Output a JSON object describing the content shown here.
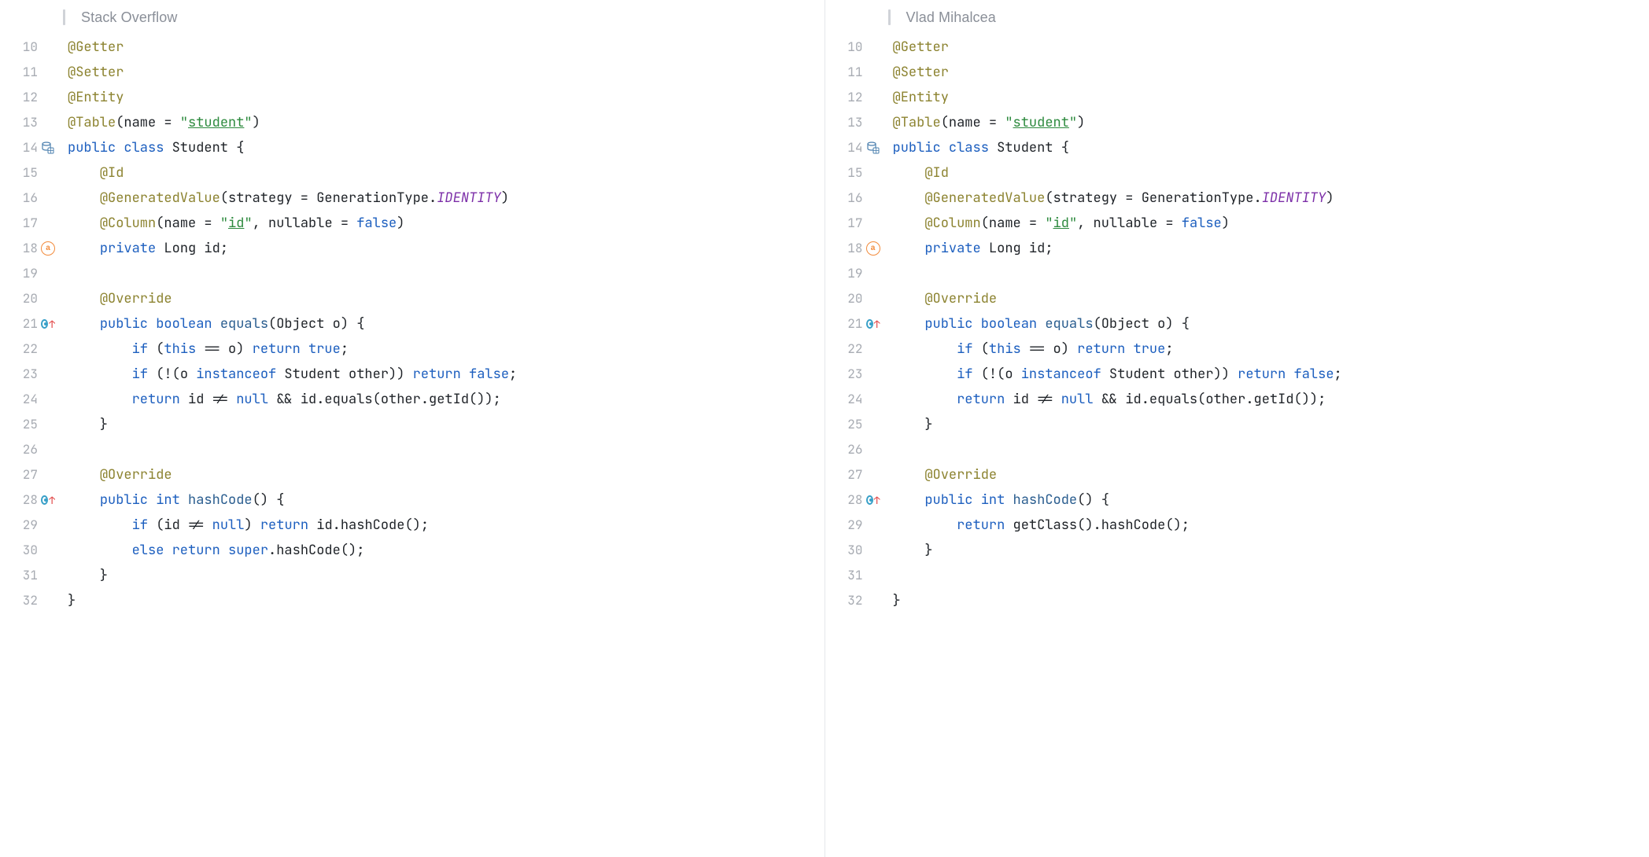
{
  "left": {
    "title": "Stack Overflow",
    "lines": [
      {
        "n": 10,
        "tokens": [
          {
            "t": "@Getter",
            "c": "anno"
          }
        ]
      },
      {
        "n": 11,
        "tokens": [
          {
            "t": "@Setter",
            "c": "anno"
          }
        ]
      },
      {
        "n": 12,
        "tokens": [
          {
            "t": "@Entity",
            "c": "anno"
          }
        ]
      },
      {
        "n": 13,
        "tokens": [
          {
            "t": "@Table",
            "c": "anno"
          },
          {
            "t": "(name = ",
            "c": "punct"
          },
          {
            "t": "\"",
            "c": "str"
          },
          {
            "t": "student",
            "c": "str strul"
          },
          {
            "t": "\"",
            "c": "str"
          },
          {
            "t": ")",
            "c": "punct"
          }
        ]
      },
      {
        "n": 14,
        "icon": "db",
        "tokens": [
          {
            "t": "public ",
            "c": "kw"
          },
          {
            "t": "class ",
            "c": "kw"
          },
          {
            "t": "Student {",
            "c": "ident"
          }
        ]
      },
      {
        "n": 15,
        "tokens": [
          {
            "t": "    ",
            "c": ""
          },
          {
            "t": "@Id",
            "c": "anno"
          }
        ]
      },
      {
        "n": 16,
        "tokens": [
          {
            "t": "    ",
            "c": ""
          },
          {
            "t": "@GeneratedValue",
            "c": "anno"
          },
          {
            "t": "(strategy = GenerationType.",
            "c": "punct"
          },
          {
            "t": "IDENTITY",
            "c": "const"
          },
          {
            "t": ")",
            "c": "punct"
          }
        ]
      },
      {
        "n": 17,
        "tokens": [
          {
            "t": "    ",
            "c": ""
          },
          {
            "t": "@Column",
            "c": "anno"
          },
          {
            "t": "(name = ",
            "c": "punct"
          },
          {
            "t": "\"",
            "c": "str"
          },
          {
            "t": "id",
            "c": "str strul"
          },
          {
            "t": "\"",
            "c": "str"
          },
          {
            "t": ", nullable = ",
            "c": "punct"
          },
          {
            "t": "false",
            "c": "kw"
          },
          {
            "t": ")",
            "c": "punct"
          }
        ]
      },
      {
        "n": 18,
        "icon": "at",
        "tokens": [
          {
            "t": "    ",
            "c": ""
          },
          {
            "t": "private ",
            "c": "kw"
          },
          {
            "t": "Long id;",
            "c": "ident"
          }
        ]
      },
      {
        "n": 19,
        "tokens": []
      },
      {
        "n": 20,
        "tokens": [
          {
            "t": "    ",
            "c": ""
          },
          {
            "t": "@Override",
            "c": "anno"
          }
        ]
      },
      {
        "n": 21,
        "icon": "ov",
        "tokens": [
          {
            "t": "    ",
            "c": ""
          },
          {
            "t": "public ",
            "c": "kw"
          },
          {
            "t": "boolean ",
            "c": "kw"
          },
          {
            "t": "equals",
            "c": "method"
          },
          {
            "t": "(Object o) {",
            "c": "ident"
          }
        ]
      },
      {
        "n": 22,
        "tokens": [
          {
            "t": "        ",
            "c": ""
          },
          {
            "t": "if ",
            "c": "kw"
          },
          {
            "t": "(",
            "c": "punct"
          },
          {
            "t": "this ",
            "c": "kw"
          },
          {
            "t": "== o) ",
            "c": "punct"
          },
          {
            "t": "return ",
            "c": "kw"
          },
          {
            "t": "true",
            "c": "kw"
          },
          {
            "t": ";",
            "c": "punct"
          }
        ]
      },
      {
        "n": 23,
        "tokens": [
          {
            "t": "        ",
            "c": ""
          },
          {
            "t": "if ",
            "c": "kw"
          },
          {
            "t": "(!(o ",
            "c": "punct"
          },
          {
            "t": "instanceof ",
            "c": "kw"
          },
          {
            "t": "Student other)) ",
            "c": "ident"
          },
          {
            "t": "return ",
            "c": "kw"
          },
          {
            "t": "false",
            "c": "kw"
          },
          {
            "t": ";",
            "c": "punct"
          }
        ]
      },
      {
        "n": 24,
        "tokens": [
          {
            "t": "        ",
            "c": ""
          },
          {
            "t": "return ",
            "c": "kw"
          },
          {
            "t": "id != ",
            "c": "ident"
          },
          {
            "t": "null ",
            "c": "kw"
          },
          {
            "t": "&& id.equals(other.getId());",
            "c": "ident"
          }
        ]
      },
      {
        "n": 25,
        "tokens": [
          {
            "t": "    }",
            "c": "ident"
          }
        ]
      },
      {
        "n": 26,
        "tokens": []
      },
      {
        "n": 27,
        "tokens": [
          {
            "t": "    ",
            "c": ""
          },
          {
            "t": "@Override",
            "c": "anno"
          }
        ]
      },
      {
        "n": 28,
        "icon": "ov",
        "tokens": [
          {
            "t": "    ",
            "c": ""
          },
          {
            "t": "public ",
            "c": "kw"
          },
          {
            "t": "int ",
            "c": "kw"
          },
          {
            "t": "hashCode",
            "c": "method"
          },
          {
            "t": "() {",
            "c": "ident"
          }
        ]
      },
      {
        "n": 29,
        "tokens": [
          {
            "t": "        ",
            "c": ""
          },
          {
            "t": "if ",
            "c": "kw"
          },
          {
            "t": "(id != ",
            "c": "ident"
          },
          {
            "t": "null",
            "c": "kw"
          },
          {
            "t": ") ",
            "c": "punct"
          },
          {
            "t": "return ",
            "c": "kw"
          },
          {
            "t": "id.hashCode();",
            "c": "ident"
          }
        ]
      },
      {
        "n": 30,
        "tokens": [
          {
            "t": "        ",
            "c": ""
          },
          {
            "t": "else ",
            "c": "kw"
          },
          {
            "t": "return ",
            "c": "kw"
          },
          {
            "t": "super",
            "c": "kw"
          },
          {
            "t": ".hashCode();",
            "c": "ident"
          }
        ]
      },
      {
        "n": 31,
        "tokens": [
          {
            "t": "    }",
            "c": "ident"
          }
        ]
      },
      {
        "n": 32,
        "tokens": [
          {
            "t": "}",
            "c": "ident"
          }
        ]
      }
    ]
  },
  "right": {
    "title": "Vlad Mihalcea",
    "lines": [
      {
        "n": 10,
        "tokens": [
          {
            "t": "@Getter",
            "c": "anno"
          }
        ]
      },
      {
        "n": 11,
        "tokens": [
          {
            "t": "@Setter",
            "c": "anno"
          }
        ]
      },
      {
        "n": 12,
        "tokens": [
          {
            "t": "@Entity",
            "c": "anno"
          }
        ]
      },
      {
        "n": 13,
        "tokens": [
          {
            "t": "@Table",
            "c": "anno"
          },
          {
            "t": "(name = ",
            "c": "punct"
          },
          {
            "t": "\"",
            "c": "str"
          },
          {
            "t": "student",
            "c": "str strul"
          },
          {
            "t": "\"",
            "c": "str"
          },
          {
            "t": ")",
            "c": "punct"
          }
        ]
      },
      {
        "n": 14,
        "icon": "db",
        "tokens": [
          {
            "t": "public ",
            "c": "kw"
          },
          {
            "t": "class ",
            "c": "kw"
          },
          {
            "t": "Student {",
            "c": "ident"
          }
        ]
      },
      {
        "n": 15,
        "tokens": [
          {
            "t": "    ",
            "c": ""
          },
          {
            "t": "@Id",
            "c": "anno"
          }
        ]
      },
      {
        "n": 16,
        "tokens": [
          {
            "t": "    ",
            "c": ""
          },
          {
            "t": "@GeneratedValue",
            "c": "anno"
          },
          {
            "t": "(strategy = GenerationType.",
            "c": "punct"
          },
          {
            "t": "IDENTITY",
            "c": "const"
          },
          {
            "t": ")",
            "c": "punct"
          }
        ]
      },
      {
        "n": 17,
        "tokens": [
          {
            "t": "    ",
            "c": ""
          },
          {
            "t": "@Column",
            "c": "anno"
          },
          {
            "t": "(name = ",
            "c": "punct"
          },
          {
            "t": "\"",
            "c": "str"
          },
          {
            "t": "id",
            "c": "str strul"
          },
          {
            "t": "\"",
            "c": "str"
          },
          {
            "t": ", nullable = ",
            "c": "punct"
          },
          {
            "t": "false",
            "c": "kw"
          },
          {
            "t": ")",
            "c": "punct"
          }
        ]
      },
      {
        "n": 18,
        "icon": "at",
        "tokens": [
          {
            "t": "    ",
            "c": ""
          },
          {
            "t": "private ",
            "c": "kw"
          },
          {
            "t": "Long id;",
            "c": "ident"
          }
        ]
      },
      {
        "n": 19,
        "tokens": []
      },
      {
        "n": 20,
        "tokens": [
          {
            "t": "    ",
            "c": ""
          },
          {
            "t": "@Override",
            "c": "anno"
          }
        ]
      },
      {
        "n": 21,
        "icon": "ov",
        "tokens": [
          {
            "t": "    ",
            "c": ""
          },
          {
            "t": "public ",
            "c": "kw"
          },
          {
            "t": "boolean ",
            "c": "kw"
          },
          {
            "t": "equals",
            "c": "method"
          },
          {
            "t": "(Object o) {",
            "c": "ident"
          }
        ]
      },
      {
        "n": 22,
        "tokens": [
          {
            "t": "        ",
            "c": ""
          },
          {
            "t": "if ",
            "c": "kw"
          },
          {
            "t": "(",
            "c": "punct"
          },
          {
            "t": "this ",
            "c": "kw"
          },
          {
            "t": "== o) ",
            "c": "punct"
          },
          {
            "t": "return ",
            "c": "kw"
          },
          {
            "t": "true",
            "c": "kw"
          },
          {
            "t": ";",
            "c": "punct"
          }
        ]
      },
      {
        "n": 23,
        "tokens": [
          {
            "t": "        ",
            "c": ""
          },
          {
            "t": "if ",
            "c": "kw"
          },
          {
            "t": "(!(o ",
            "c": "punct"
          },
          {
            "t": "instanceof ",
            "c": "kw"
          },
          {
            "t": "Student other)) ",
            "c": "ident"
          },
          {
            "t": "return ",
            "c": "kw"
          },
          {
            "t": "false",
            "c": "kw"
          },
          {
            "t": ";",
            "c": "punct"
          }
        ]
      },
      {
        "n": 24,
        "tokens": [
          {
            "t": "        ",
            "c": ""
          },
          {
            "t": "return ",
            "c": "kw"
          },
          {
            "t": "id != ",
            "c": "ident"
          },
          {
            "t": "null ",
            "c": "kw"
          },
          {
            "t": "&& id.equals(other.getId());",
            "c": "ident"
          }
        ]
      },
      {
        "n": 25,
        "tokens": [
          {
            "t": "    }",
            "c": "ident"
          }
        ]
      },
      {
        "n": 26,
        "tokens": []
      },
      {
        "n": 27,
        "tokens": [
          {
            "t": "    ",
            "c": ""
          },
          {
            "t": "@Override",
            "c": "anno"
          }
        ]
      },
      {
        "n": 28,
        "icon": "ov",
        "tokens": [
          {
            "t": "    ",
            "c": ""
          },
          {
            "t": "public ",
            "c": "kw"
          },
          {
            "t": "int ",
            "c": "kw"
          },
          {
            "t": "hashCode",
            "c": "method"
          },
          {
            "t": "() {",
            "c": "ident"
          }
        ]
      },
      {
        "n": 29,
        "tokens": [
          {
            "t": "        ",
            "c": ""
          },
          {
            "t": "return ",
            "c": "kw"
          },
          {
            "t": "getClass().hashCode();",
            "c": "ident"
          }
        ]
      },
      {
        "n": 30,
        "tokens": [
          {
            "t": "    }",
            "c": "ident"
          }
        ]
      },
      {
        "n": 31,
        "tokens": []
      },
      {
        "n": 32,
        "tokens": [
          {
            "t": "}",
            "c": "ident"
          }
        ]
      }
    ]
  }
}
